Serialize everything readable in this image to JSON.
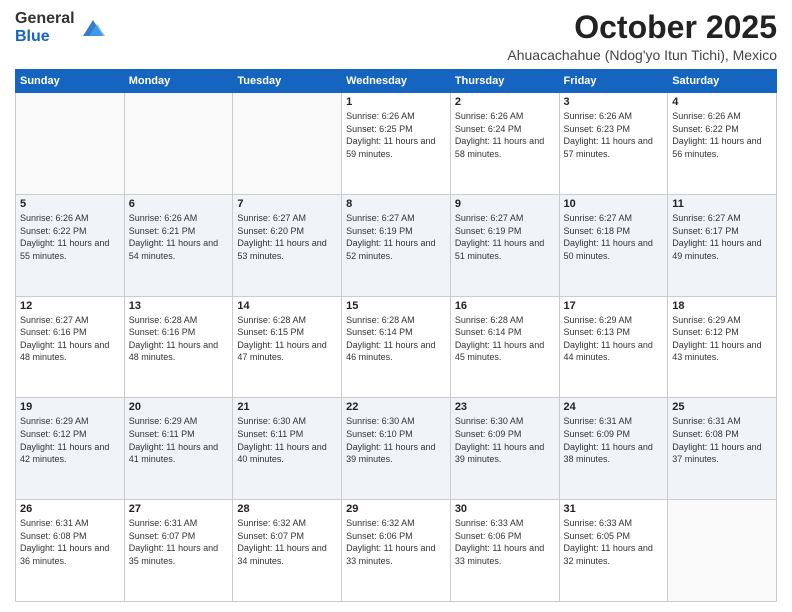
{
  "logo": {
    "general": "General",
    "blue": "Blue"
  },
  "title": "October 2025",
  "location": "Ahuacachahue (Ndog'yo Itun Tichi), Mexico",
  "days_of_week": [
    "Sunday",
    "Monday",
    "Tuesday",
    "Wednesday",
    "Thursday",
    "Friday",
    "Saturday"
  ],
  "weeks": [
    [
      {
        "day": "",
        "info": ""
      },
      {
        "day": "",
        "info": ""
      },
      {
        "day": "",
        "info": ""
      },
      {
        "day": "1",
        "info": "Sunrise: 6:26 AM\nSunset: 6:25 PM\nDaylight: 11 hours and 59 minutes."
      },
      {
        "day": "2",
        "info": "Sunrise: 6:26 AM\nSunset: 6:24 PM\nDaylight: 11 hours and 58 minutes."
      },
      {
        "day": "3",
        "info": "Sunrise: 6:26 AM\nSunset: 6:23 PM\nDaylight: 11 hours and 57 minutes."
      },
      {
        "day": "4",
        "info": "Sunrise: 6:26 AM\nSunset: 6:22 PM\nDaylight: 11 hours and 56 minutes."
      }
    ],
    [
      {
        "day": "5",
        "info": "Sunrise: 6:26 AM\nSunset: 6:22 PM\nDaylight: 11 hours and 55 minutes."
      },
      {
        "day": "6",
        "info": "Sunrise: 6:26 AM\nSunset: 6:21 PM\nDaylight: 11 hours and 54 minutes."
      },
      {
        "day": "7",
        "info": "Sunrise: 6:27 AM\nSunset: 6:20 PM\nDaylight: 11 hours and 53 minutes."
      },
      {
        "day": "8",
        "info": "Sunrise: 6:27 AM\nSunset: 6:19 PM\nDaylight: 11 hours and 52 minutes."
      },
      {
        "day": "9",
        "info": "Sunrise: 6:27 AM\nSunset: 6:19 PM\nDaylight: 11 hours and 51 minutes."
      },
      {
        "day": "10",
        "info": "Sunrise: 6:27 AM\nSunset: 6:18 PM\nDaylight: 11 hours and 50 minutes."
      },
      {
        "day": "11",
        "info": "Sunrise: 6:27 AM\nSunset: 6:17 PM\nDaylight: 11 hours and 49 minutes."
      }
    ],
    [
      {
        "day": "12",
        "info": "Sunrise: 6:27 AM\nSunset: 6:16 PM\nDaylight: 11 hours and 48 minutes."
      },
      {
        "day": "13",
        "info": "Sunrise: 6:28 AM\nSunset: 6:16 PM\nDaylight: 11 hours and 48 minutes."
      },
      {
        "day": "14",
        "info": "Sunrise: 6:28 AM\nSunset: 6:15 PM\nDaylight: 11 hours and 47 minutes."
      },
      {
        "day": "15",
        "info": "Sunrise: 6:28 AM\nSunset: 6:14 PM\nDaylight: 11 hours and 46 minutes."
      },
      {
        "day": "16",
        "info": "Sunrise: 6:28 AM\nSunset: 6:14 PM\nDaylight: 11 hours and 45 minutes."
      },
      {
        "day": "17",
        "info": "Sunrise: 6:29 AM\nSunset: 6:13 PM\nDaylight: 11 hours and 44 minutes."
      },
      {
        "day": "18",
        "info": "Sunrise: 6:29 AM\nSunset: 6:12 PM\nDaylight: 11 hours and 43 minutes."
      }
    ],
    [
      {
        "day": "19",
        "info": "Sunrise: 6:29 AM\nSunset: 6:12 PM\nDaylight: 11 hours and 42 minutes."
      },
      {
        "day": "20",
        "info": "Sunrise: 6:29 AM\nSunset: 6:11 PM\nDaylight: 11 hours and 41 minutes."
      },
      {
        "day": "21",
        "info": "Sunrise: 6:30 AM\nSunset: 6:11 PM\nDaylight: 11 hours and 40 minutes."
      },
      {
        "day": "22",
        "info": "Sunrise: 6:30 AM\nSunset: 6:10 PM\nDaylight: 11 hours and 39 minutes."
      },
      {
        "day": "23",
        "info": "Sunrise: 6:30 AM\nSunset: 6:09 PM\nDaylight: 11 hours and 39 minutes."
      },
      {
        "day": "24",
        "info": "Sunrise: 6:31 AM\nSunset: 6:09 PM\nDaylight: 11 hours and 38 minutes."
      },
      {
        "day": "25",
        "info": "Sunrise: 6:31 AM\nSunset: 6:08 PM\nDaylight: 11 hours and 37 minutes."
      }
    ],
    [
      {
        "day": "26",
        "info": "Sunrise: 6:31 AM\nSunset: 6:08 PM\nDaylight: 11 hours and 36 minutes."
      },
      {
        "day": "27",
        "info": "Sunrise: 6:31 AM\nSunset: 6:07 PM\nDaylight: 11 hours and 35 minutes."
      },
      {
        "day": "28",
        "info": "Sunrise: 6:32 AM\nSunset: 6:07 PM\nDaylight: 11 hours and 34 minutes."
      },
      {
        "day": "29",
        "info": "Sunrise: 6:32 AM\nSunset: 6:06 PM\nDaylight: 11 hours and 33 minutes."
      },
      {
        "day": "30",
        "info": "Sunrise: 6:33 AM\nSunset: 6:06 PM\nDaylight: 11 hours and 33 minutes."
      },
      {
        "day": "31",
        "info": "Sunrise: 6:33 AM\nSunset: 6:05 PM\nDaylight: 11 hours and 32 minutes."
      },
      {
        "day": "",
        "info": ""
      }
    ]
  ]
}
